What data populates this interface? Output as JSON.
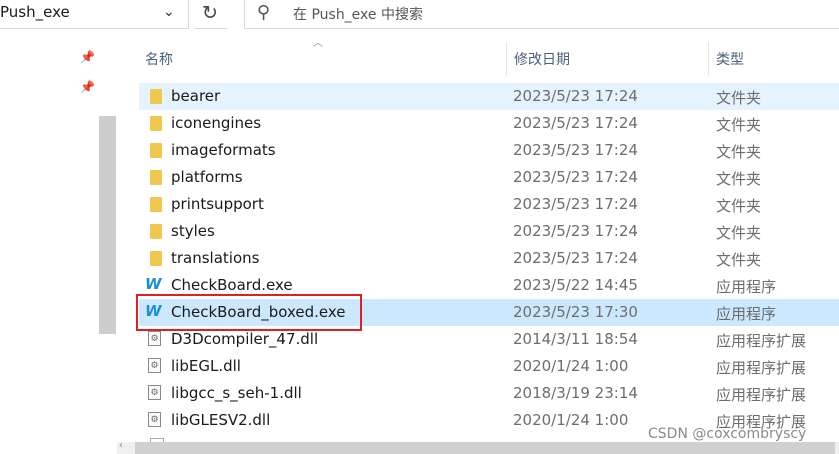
{
  "address": {
    "path": "Push_exe",
    "chevron": "⌄"
  },
  "refresh_icon": "refresh-icon",
  "search": {
    "placeholder": "在 Push_exe 中搜索"
  },
  "columns": {
    "name": "名称",
    "date": "修改日期",
    "type": "类型"
  },
  "files": [
    {
      "name": "bearer",
      "date": "2023/5/23 17:24",
      "type": "文件夹",
      "kind": "folder",
      "state": "hover"
    },
    {
      "name": "iconengines",
      "date": "2023/5/23 17:24",
      "type": "文件夹",
      "kind": "folder"
    },
    {
      "name": "imageformats",
      "date": "2023/5/23 17:24",
      "type": "文件夹",
      "kind": "folder"
    },
    {
      "name": "platforms",
      "date": "2023/5/23 17:24",
      "type": "文件夹",
      "kind": "folder"
    },
    {
      "name": "printsupport",
      "date": "2023/5/23 17:24",
      "type": "文件夹",
      "kind": "folder"
    },
    {
      "name": "styles",
      "date": "2023/5/23 17:24",
      "type": "文件夹",
      "kind": "folder"
    },
    {
      "name": "translations",
      "date": "2023/5/23 17:24",
      "type": "文件夹",
      "kind": "folder"
    },
    {
      "name": "CheckBoard.exe",
      "date": "2023/5/22 14:45",
      "type": "应用程序",
      "kind": "exe"
    },
    {
      "name": "CheckBoard_boxed.exe",
      "date": "2023/5/23 17:30",
      "type": "应用程序",
      "kind": "exe",
      "state": "selected"
    },
    {
      "name": "D3Dcompiler_47.dll",
      "date": "2014/3/11 18:54",
      "type": "应用程序扩展",
      "kind": "dll"
    },
    {
      "name": "libEGL.dll",
      "date": "2020/1/24 1:00",
      "type": "应用程序扩展",
      "kind": "dll"
    },
    {
      "name": "libgcc_s_seh-1.dll",
      "date": "2018/3/19 23:14",
      "type": "应用程序扩展",
      "kind": "dll"
    },
    {
      "name": "libGLESV2.dll",
      "date": "2020/1/24 1:00",
      "type": "应用程序扩展",
      "kind": "dll"
    }
  ],
  "watermark": "CSDN @coxcombryscy",
  "colors": {
    "hover": "#e5f3ff",
    "selected": "#cce8ff",
    "highlight_box": "#e02020"
  }
}
